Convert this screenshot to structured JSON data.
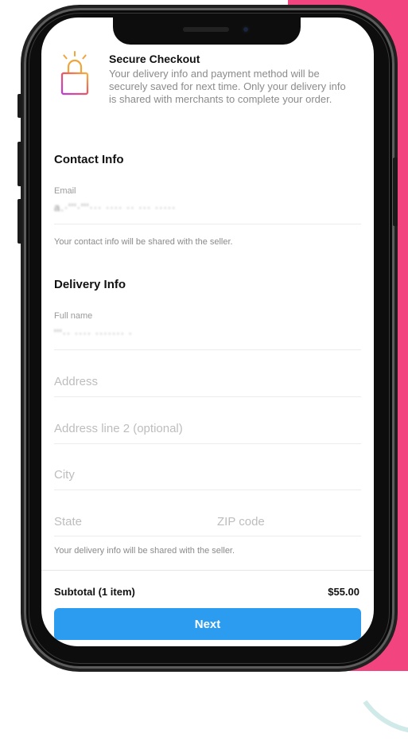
{
  "secure_checkout": {
    "title": "Secure Checkout",
    "description": "Your delivery info and payment method will be securely saved for next time. Only your delivery info is shared with merchants to complete your order.",
    "icon": "lock-icon"
  },
  "contact_info": {
    "title": "Contact Info",
    "email_label": "Email",
    "email_value": "a.·'''·'''··· ···· ·· ··· ·····",
    "helper": "Your contact info will be shared with the seller."
  },
  "delivery_info": {
    "title": "Delivery Info",
    "full_name_label": "Full name",
    "full_name_value": "'''·· ···· ·······  ·",
    "address_placeholder": "Address",
    "address2_placeholder": "Address line 2 (optional)",
    "city_placeholder": "City",
    "state_placeholder": "State",
    "zip_placeholder": "ZIP code",
    "helper": "Your delivery info will be shared with the seller."
  },
  "footer": {
    "subtotal_label": "Subtotal (1 item)",
    "subtotal_value": "$55.00",
    "next_label": "Next"
  },
  "colors": {
    "accent": "#2c9cf0",
    "pink_background": "#f2457f"
  }
}
